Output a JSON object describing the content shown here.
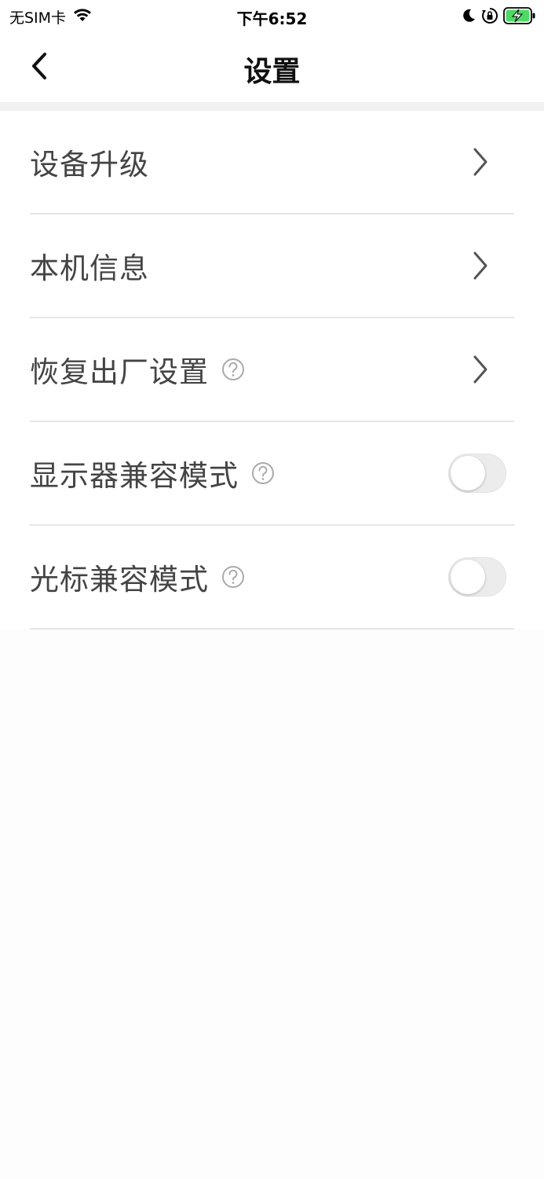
{
  "status_bar": {
    "carrier": "无SIM卡",
    "time": "下午6:52",
    "icons": [
      "wifi-icon",
      "moon-icon",
      "orientation-lock-icon",
      "battery-charging-icon"
    ],
    "battery_color": "#4cd964"
  },
  "nav": {
    "title": "设置",
    "back_icon": "chevron-left-icon"
  },
  "settings": {
    "items": [
      {
        "label": "设备升级",
        "type": "link",
        "help": false
      },
      {
        "label": "本机信息",
        "type": "link",
        "help": false
      },
      {
        "label": "恢复出厂设置",
        "type": "link",
        "help": true
      },
      {
        "label": "显示器兼容模式",
        "type": "toggle",
        "help": true,
        "on": false
      },
      {
        "label": "光标兼容模式",
        "type": "toggle",
        "help": true,
        "on": false
      }
    ]
  },
  "colors": {
    "label_text": "#444444",
    "divider": "#e6e6e6",
    "toggle_off": "#ececec"
  }
}
